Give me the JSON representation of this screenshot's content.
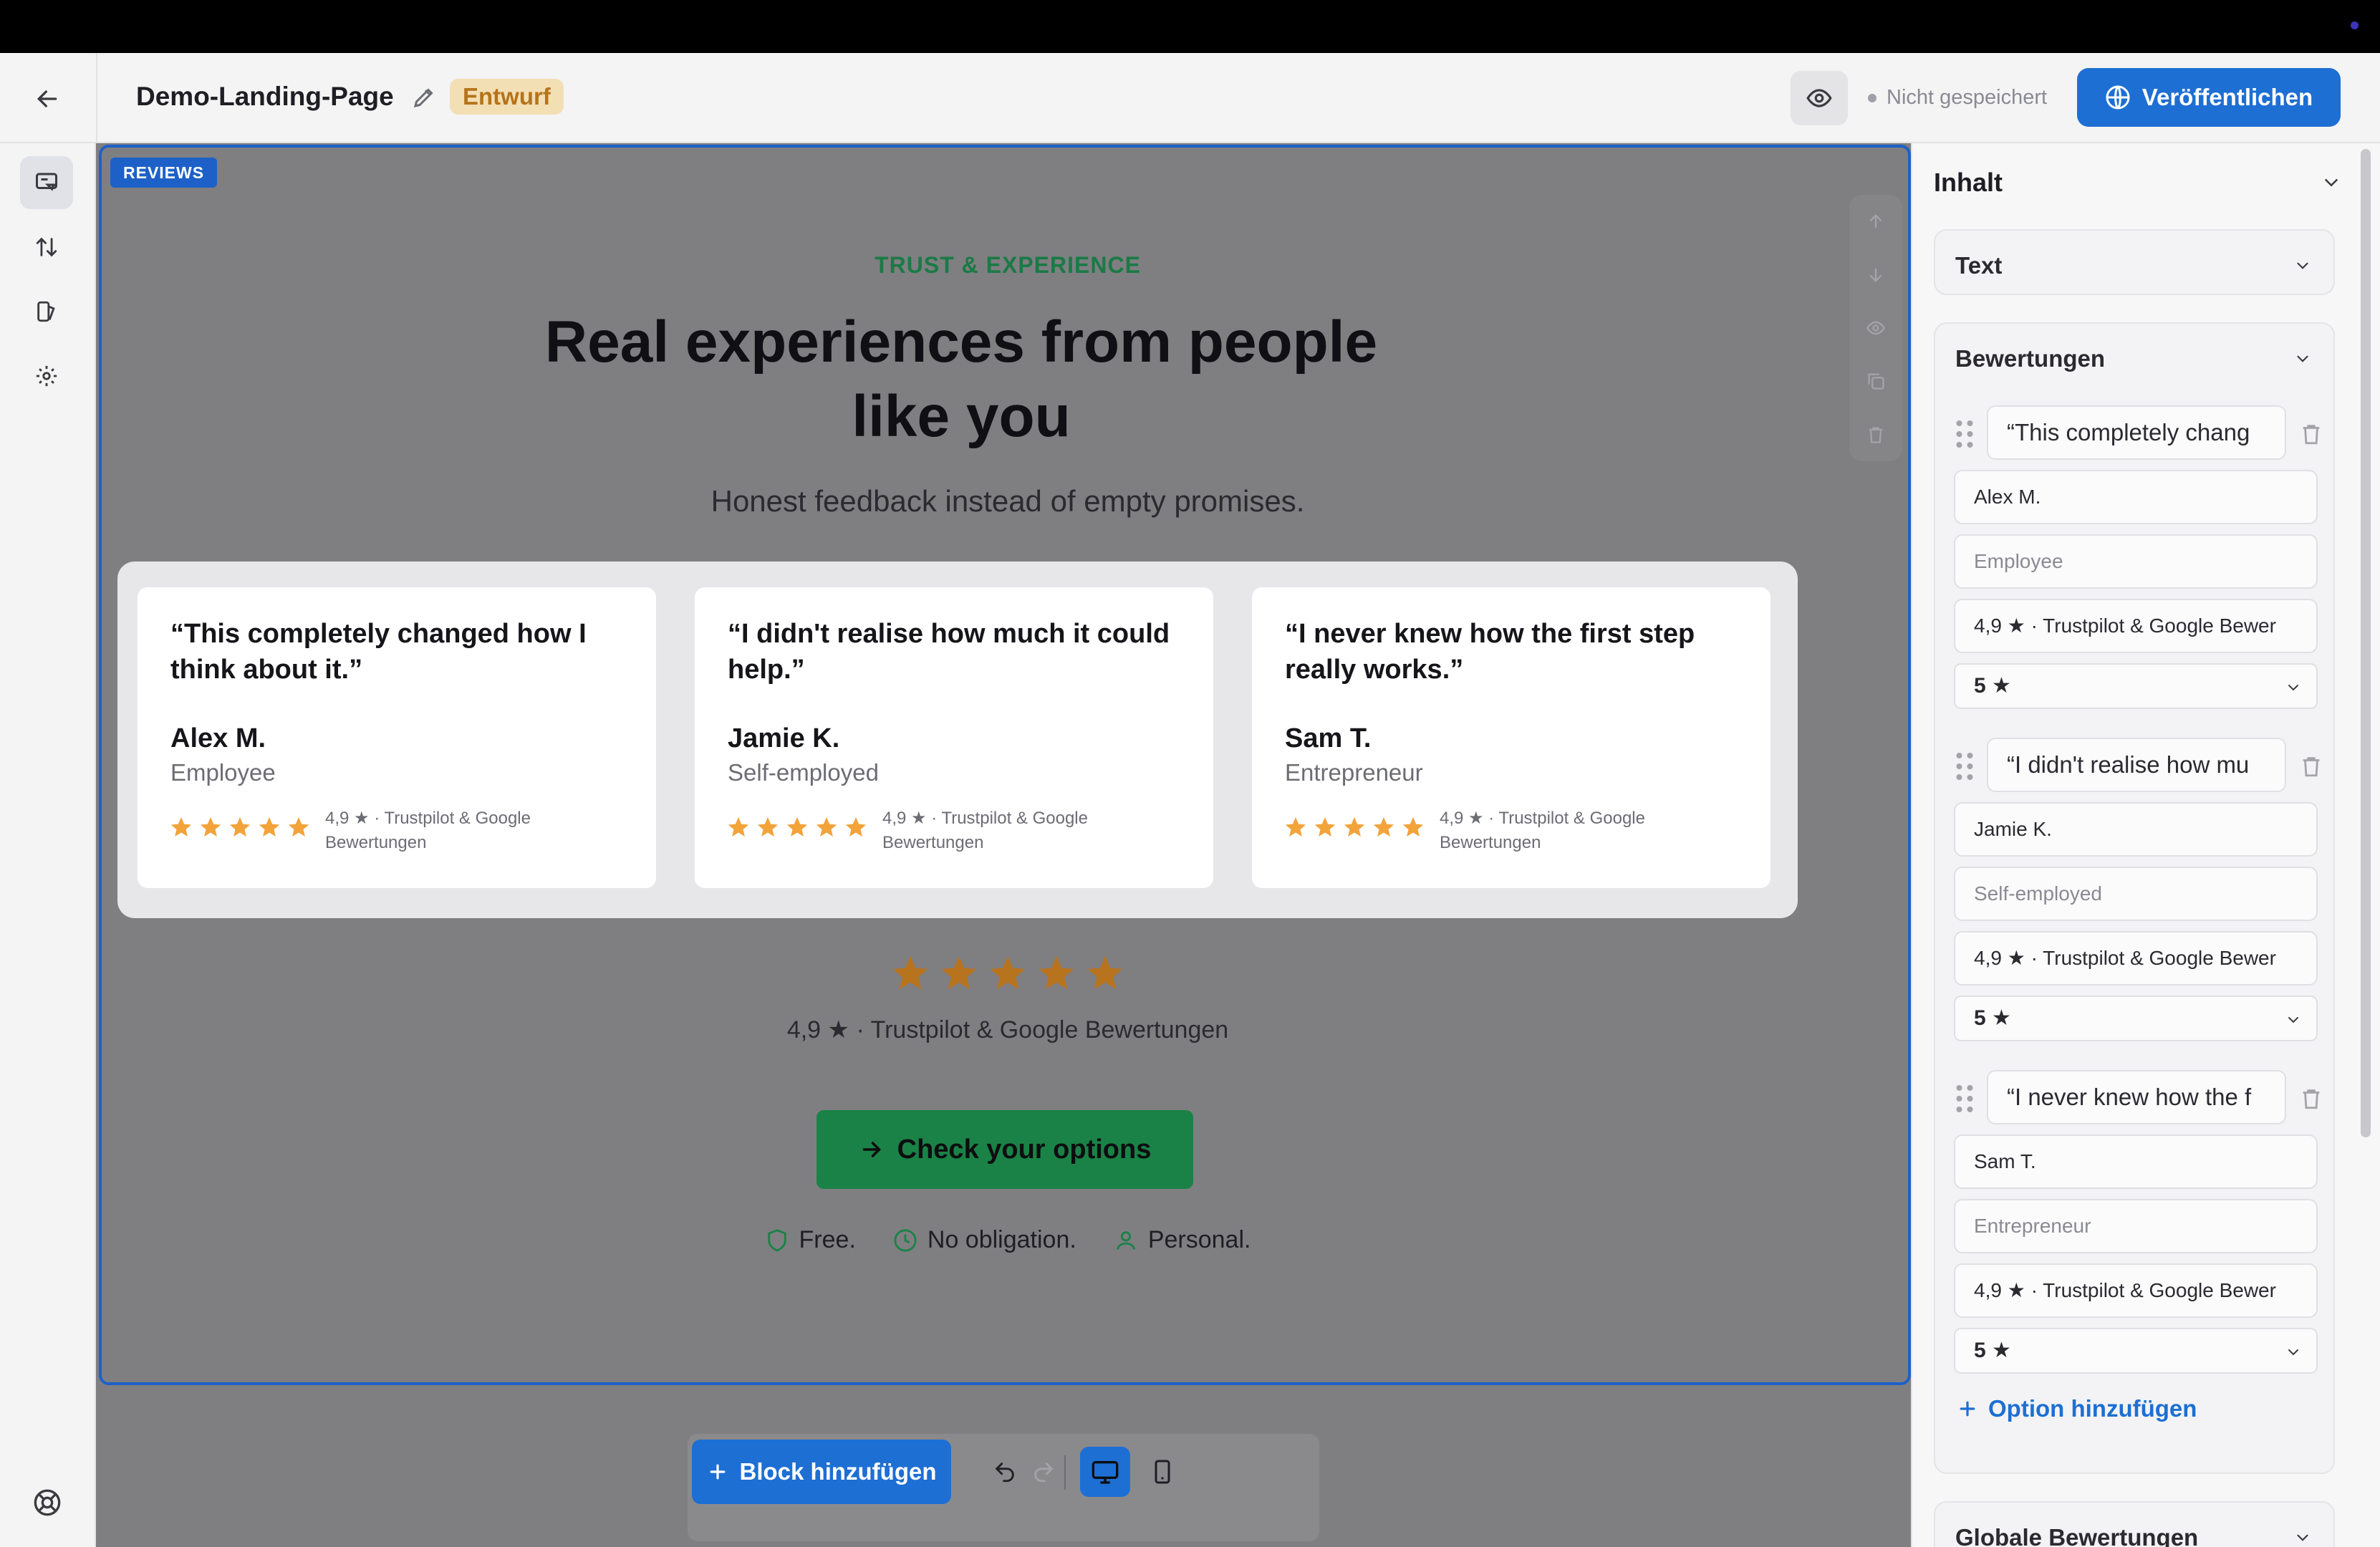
{
  "header": {
    "page_title": "Demo-Landing-Page",
    "status_badge": "Entwurf",
    "save_status": "Nicht gespeichert",
    "publish_label": "Veröffentlichen"
  },
  "section": {
    "tag": "REVIEWS",
    "eyebrow": "TRUST & EXPERIENCE",
    "headline": "Real experiences from people like you",
    "subline": "Honest feedback instead of empty promises.",
    "reviews": [
      {
        "quote": "“This completely changed how I think about it.”",
        "name": "Alex M.",
        "role": "Employee",
        "rating_text": "4,9 ★ · Trustpilot & Google Bewertungen",
        "stars": 5
      },
      {
        "quote": "“I didn't realise how much it could help.”",
        "name": "Jamie K.",
        "role": "Self-employed",
        "rating_text": "4,9 ★ · Trustpilot & Google Bewertungen",
        "stars": 5
      },
      {
        "quote": "“I never knew how the first step really works.”",
        "name": "Sam T.",
        "role": "Entrepreneur",
        "rating_text": "4,9 ★ · Trustpilot & Google Bewertungen",
        "stars": 5
      }
    ],
    "aggregate_stars": 5,
    "aggregate_text": "4,9 ★ · Trustpilot & Google Bewertungen",
    "cta_label": "Check your options",
    "benefits": [
      "Free.",
      "No obligation.",
      "Personal."
    ]
  },
  "toolbar": {
    "add_block_label": "Block hinzufügen"
  },
  "panel": {
    "title": "Inhalt",
    "text_section": "Text",
    "reviews_section": "Bewertungen",
    "items": [
      {
        "quote": "“This completely chang",
        "name": "Alex M.",
        "role": "Employee",
        "rating_text": "4,9 ★ · Trustpilot & Google Bewer",
        "stars": "5 ★"
      },
      {
        "quote": "“I didn't realise how mu",
        "name": "Jamie K.",
        "role": "Self-employed",
        "rating_text": "4,9 ★ · Trustpilot & Google Bewer",
        "stars": "5 ★"
      },
      {
        "quote": "“I never knew how the f",
        "name": "Sam T.",
        "role": "Entrepreneur",
        "rating_text": "4,9 ★ · Trustpilot & Google Bewer",
        "stars": "5 ★"
      }
    ],
    "add_option_label": "Option hinzufügen",
    "global_section": "Globale Bewertungen"
  },
  "colors": {
    "accent": "#1d6fd3",
    "cta_green": "#1a8246",
    "star": "#f2a33a",
    "draft_bg": "#f3dfb4"
  }
}
